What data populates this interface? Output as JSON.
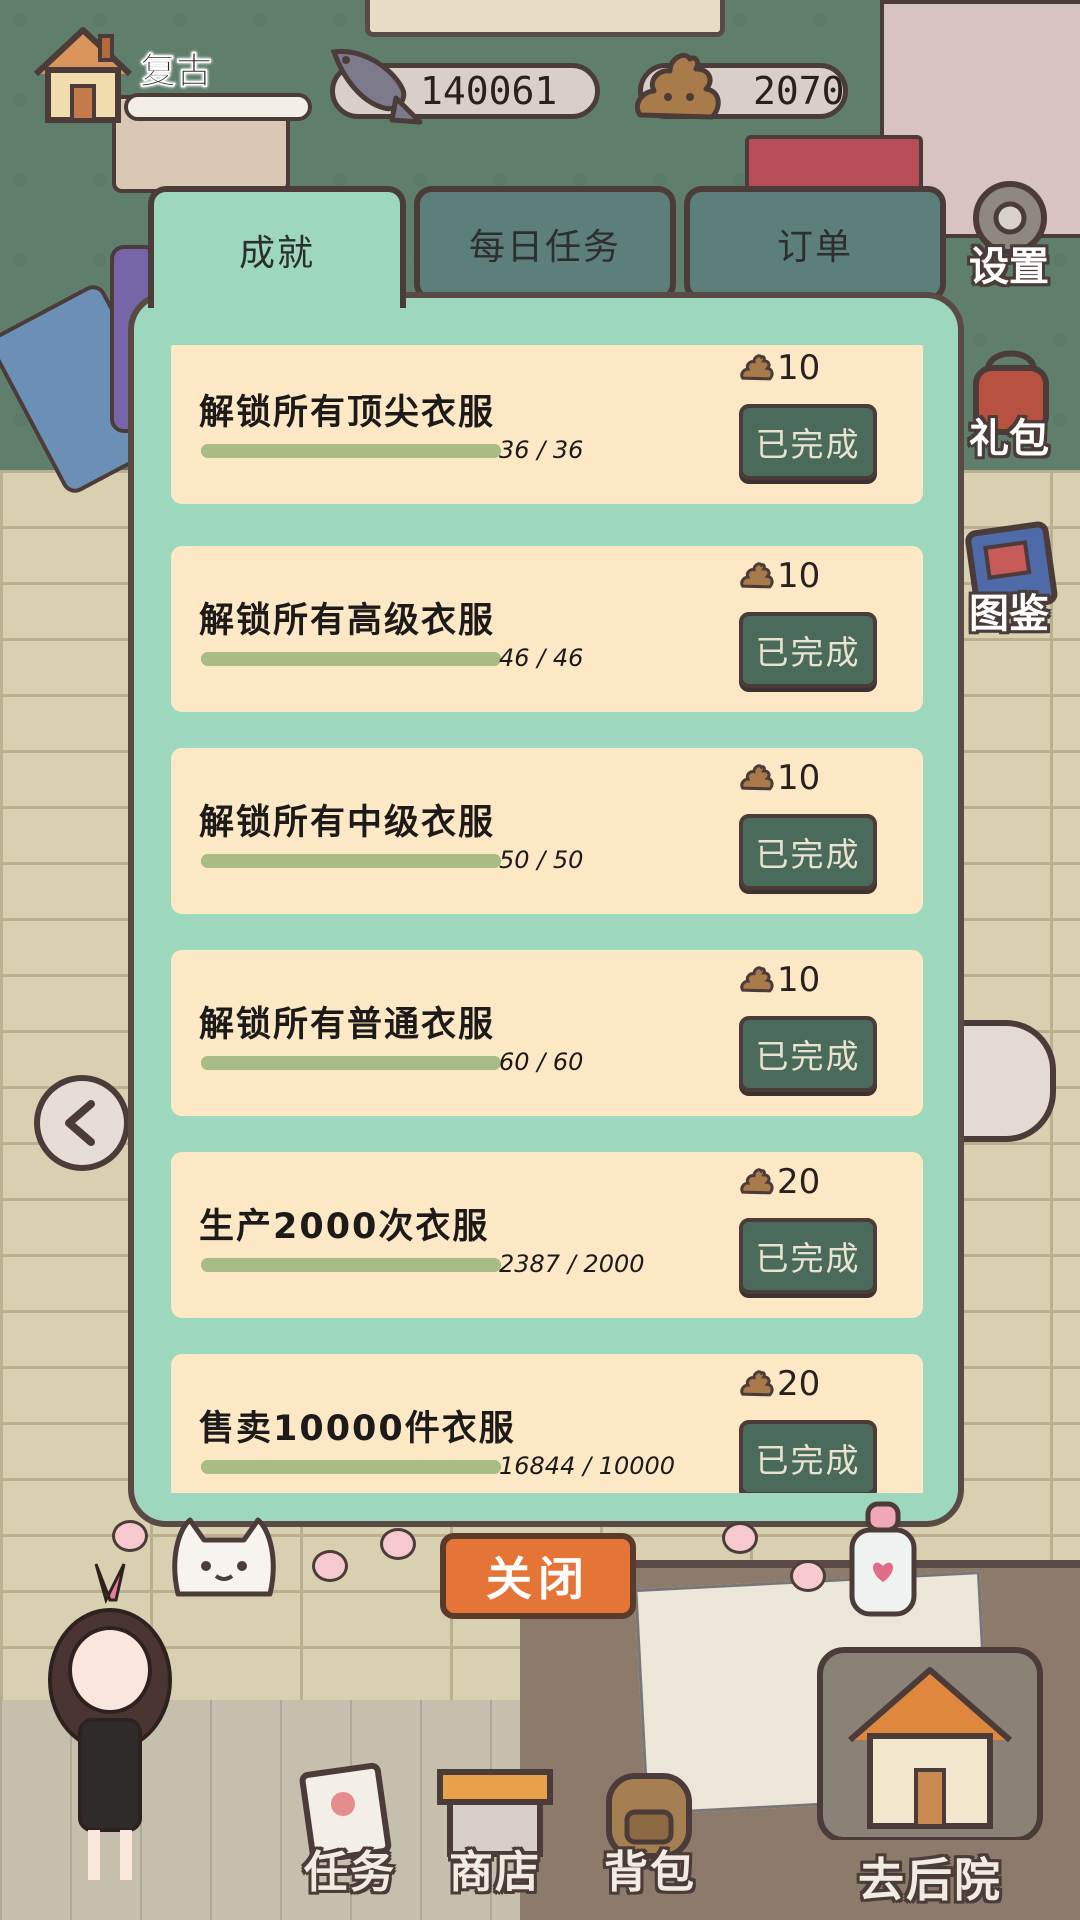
{
  "header": {
    "player_name": "复古",
    "fish_currency": "140061",
    "poop_currency": "2070"
  },
  "tabs": [
    {
      "label": "成就",
      "active": true
    },
    {
      "label": "每日任务",
      "active": false
    },
    {
      "label": "订单",
      "active": false
    }
  ],
  "side_menu": [
    {
      "label": "设置",
      "icon": "gear-icon"
    },
    {
      "label": "礼包",
      "icon": "gift-bag-icon"
    },
    {
      "label": "图鉴",
      "icon": "book-icon"
    }
  ],
  "achievements": [
    {
      "title": "解锁所有顶尖衣服",
      "progress": "36 / 36",
      "ratio": 1.0,
      "reward": "10",
      "button": "已完成"
    },
    {
      "title": "解锁所有高级衣服",
      "progress": "46 / 46",
      "ratio": 1.0,
      "reward": "10",
      "button": "已完成"
    },
    {
      "title": "解锁所有中级衣服",
      "progress": "50 / 50",
      "ratio": 1.0,
      "reward": "10",
      "button": "已完成"
    },
    {
      "title": "解锁所有普通衣服",
      "progress": "60 / 60",
      "ratio": 1.0,
      "reward": "10",
      "button": "已完成"
    },
    {
      "title": "生产2000次衣服",
      "progress": "2387 / 2000",
      "ratio": 1.0,
      "reward": "20",
      "button": "已完成"
    },
    {
      "title": "售卖10000件衣服",
      "progress": "16844 / 10000",
      "ratio": 1.0,
      "reward": "20",
      "button": "已完成"
    }
  ],
  "close_label": "关闭",
  "bottom_nav": [
    {
      "label": "任务",
      "icon": "task-note-icon"
    },
    {
      "label": "商店",
      "icon": "shop-awning-icon"
    },
    {
      "label": "背包",
      "icon": "backpack-icon"
    }
  ],
  "backyard_label": "去后院",
  "colors": {
    "panel_green": "#9dd7bd",
    "card_cream": "#fde8c6",
    "done_button": "#4a6a5c",
    "close_orange": "#e57437",
    "outline": "#4b3c3a"
  }
}
